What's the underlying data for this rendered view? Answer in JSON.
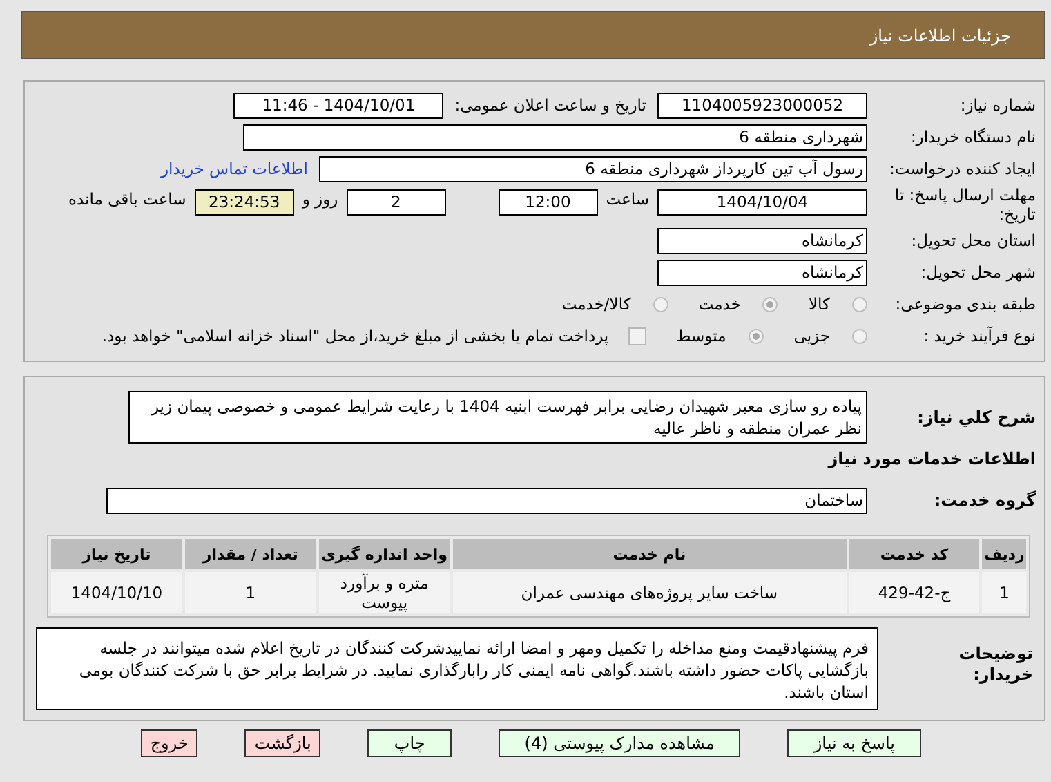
{
  "header": {
    "title": "جزئیات اطلاعات نیاز"
  },
  "need_number": {
    "label": "شماره نیاز:",
    "value": "1104005923000052"
  },
  "announce": {
    "label": "تاریخ و ساعت اعلان عمومی:",
    "value": "1404/10/01 - 11:46"
  },
  "buyer": {
    "label": "نام دستگاه خریدار:",
    "value": "شهرداری منطقه 6"
  },
  "requester": {
    "label": "ایجاد کننده درخواست:",
    "value": "رسول آب تین کارپرداز شهرداری منطقه 6",
    "link": "اطلاعات تماس خریدار"
  },
  "deadline": {
    "label": "مهلت ارسال پاسخ: تا تاریخ:",
    "date": "1404/10/04",
    "time_label": "ساعت",
    "time": "12:00",
    "days": "2",
    "days_label": "روز و",
    "remaining": "23:24:53",
    "remaining_label": "ساعت باقی مانده"
  },
  "province": {
    "label": "استان محل تحویل:",
    "value": "کرمانشاه"
  },
  "city": {
    "label": "شهر محل تحویل:",
    "value": "کرمانشاه"
  },
  "category": {
    "label": "طبقه بندی موضوعی:",
    "options": [
      {
        "label": "کالا",
        "selected": false
      },
      {
        "label": "خدمت",
        "selected": true
      },
      {
        "label": "کالا/خدمت",
        "selected": false
      }
    ]
  },
  "process": {
    "label": "نوع فرآیند خرید :",
    "options": [
      {
        "label": "جزیی",
        "selected": false
      },
      {
        "label": "متوسط",
        "selected": true
      }
    ],
    "payment": {
      "checked": false,
      "label": "پرداخت تمام یا بخشی از مبلغ خرید،از محل \"اسناد خزانه اسلامی\" خواهد بود."
    }
  },
  "description": {
    "label": "شرح کلي نیاز:",
    "value": "پیاده رو سازی معبر شهیدان رضایی برابر فهرست ابنیه 1404 با رعایت شرایط عمومی و خصوصی پیمان زیر نظر عمران منطقه و ناظر عالیه"
  },
  "services_title": "اطلاعات خدمات مورد نیاز",
  "service_group": {
    "label": "گروه خدمت:",
    "value": "ساختمان"
  },
  "table": {
    "columns": [
      "ردیف",
      "کد خدمت",
      "نام خدمت",
      "واحد اندازه گیری",
      "تعداد / مقدار",
      "تاریخ نیاز"
    ],
    "rows": [
      [
        "1",
        "ج-42-429",
        "ساخت سایر پروژه‌های مهندسی عمران",
        "متره و برآورد پیوست",
        "1",
        "1404/10/10"
      ]
    ]
  },
  "buyer_notes": {
    "label": "توضیحات خریدار:",
    "value": "فرم پیشنهادقیمت ومنع مداخله را تکمیل ومهر و امضا ارائه نمایید‌شرکت کنندگان در تاریخ اعلام شده میتوانند در جلسه بازگشایی پاکات حضور داشته باشند.گواهی نامه ایمنی کار  رابارگذاری نمایید. در شرایط برابر حق با شرکت کنندگان بومی استان باشند."
  },
  "buttons": [
    {
      "label": "پاسخ به نیاز",
      "kind": "normal"
    },
    {
      "label": "مشاهده مدارک پیوستی (4)",
      "kind": "normal"
    },
    {
      "label": "چاپ",
      "kind": "normal"
    },
    {
      "label": "بازگشت",
      "kind": "alert"
    },
    {
      "label": "خروج",
      "kind": "alert"
    }
  ]
}
